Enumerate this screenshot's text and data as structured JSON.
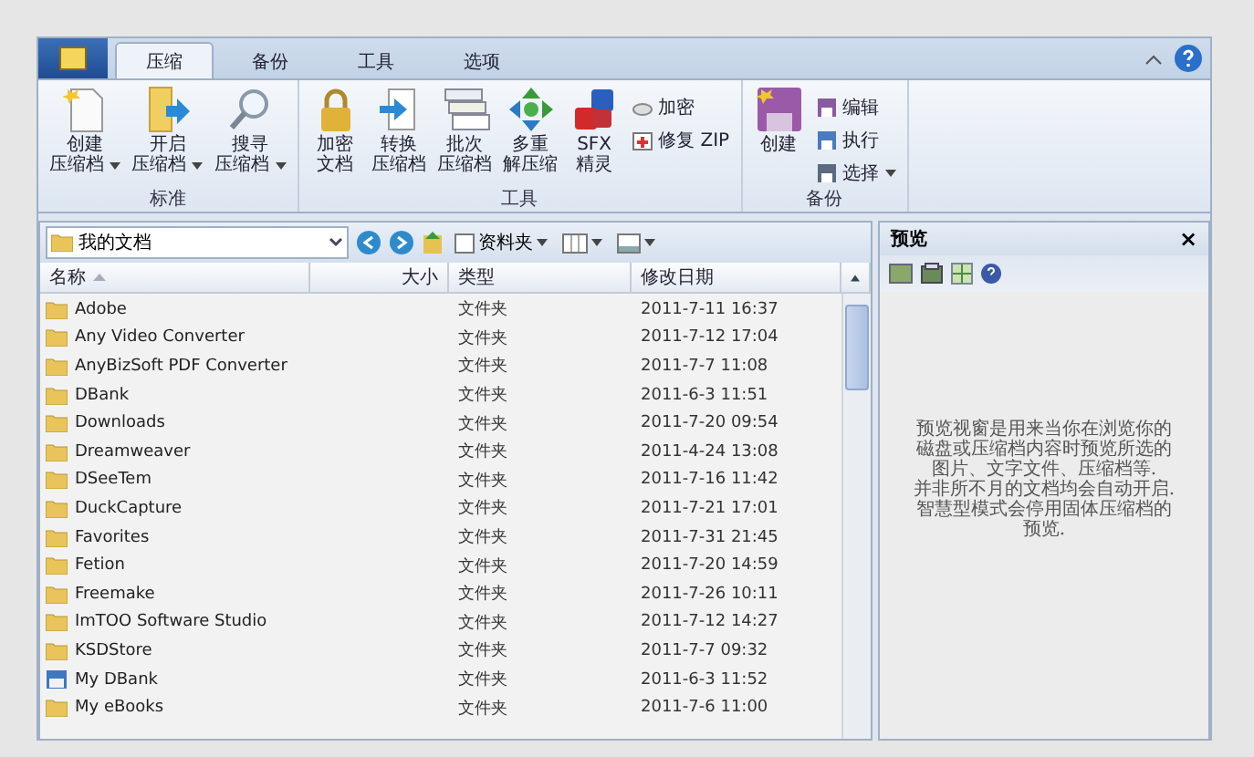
{
  "tabs": [
    {
      "label": "压缩",
      "selected": true
    },
    {
      "label": "备份",
      "selected": false
    },
    {
      "label": "工具",
      "selected": false
    },
    {
      "label": "选项",
      "selected": false
    }
  ],
  "ribbon_groups": [
    {
      "label": "标准",
      "items": [
        {
          "kind": "large",
          "lines": [
            "创建",
            "压缩档"
          ],
          "dropdown": true
        },
        {
          "kind": "large",
          "lines": [
            "开启",
            "压缩档"
          ],
          "dropdown": true
        },
        {
          "kind": "large",
          "lines": [
            "搜寻",
            "压缩档"
          ],
          "dropdown": true
        }
      ]
    },
    {
      "label": "工具",
      "items": [
        {
          "kind": "large",
          "lines": [
            "加密",
            "文档"
          ],
          "dropdown": false
        },
        {
          "kind": "large",
          "lines": [
            "转换",
            "压缩档"
          ],
          "dropdown": false
        },
        {
          "kind": "large",
          "lines": [
            "批次",
            "压缩档"
          ],
          "dropdown": false
        },
        {
          "kind": "large",
          "lines": [
            "多重",
            "解压缩"
          ],
          "dropdown": false
        },
        {
          "kind": "large",
          "lines": [
            "SFX",
            "精灵"
          ],
          "dropdown": false
        },
        {
          "kind": "small",
          "lines": [
            "加密"
          ],
          "dropdown": false
        },
        {
          "kind": "small",
          "lines": [
            "修复 ZIP"
          ],
          "dropdown": false
        }
      ]
    },
    {
      "label": "备份",
      "items": [
        {
          "kind": "large",
          "lines": [
            "创建"
          ],
          "dropdown": false
        },
        {
          "kind": "small",
          "lines": [
            "编辑"
          ],
          "dropdown": false
        },
        {
          "kind": "small",
          "lines": [
            "执行"
          ],
          "dropdown": false
        },
        {
          "kind": "small",
          "lines": [
            "选择"
          ],
          "dropdown": true
        }
      ]
    }
  ],
  "address": {
    "value": "我的文档"
  },
  "toolbar": {
    "folders_button": "资料夹"
  },
  "columns": [
    {
      "label": "名称",
      "sorted": true
    },
    {
      "label": "大小",
      "sorted": false
    },
    {
      "label": "类型",
      "sorted": false
    },
    {
      "label": "修改日期",
      "sorted": false
    }
  ],
  "rows": [
    {
      "kind": "folder",
      "name": "Adobe",
      "type": "文件夹",
      "date": "2011-7-11 16:37"
    },
    {
      "kind": "folder",
      "name": "Any Video Converter",
      "type": "文件夹",
      "date": "2011-7-12 17:04"
    },
    {
      "kind": "folder",
      "name": "AnyBizSoft PDF Converter",
      "type": "文件夹",
      "date": "2011-7-7 11:08"
    },
    {
      "kind": "folder",
      "name": "DBank",
      "type": "文件夹",
      "date": "2011-6-3 11:51"
    },
    {
      "kind": "folder",
      "name": "Downloads",
      "type": "文件夹",
      "date": "2011-7-20 09:54"
    },
    {
      "kind": "folder",
      "name": "Dreamweaver",
      "type": "文件夹",
      "date": "2011-4-24 13:08"
    },
    {
      "kind": "folder",
      "name": "DSeeTem",
      "type": "文件夹",
      "date": "2011-7-16 11:42"
    },
    {
      "kind": "folder",
      "name": "DuckCapture",
      "type": "文件夹",
      "date": "2011-7-21 17:01"
    },
    {
      "kind": "folder",
      "name": "Favorites",
      "type": "文件夹",
      "date": "2011-7-31 21:45"
    },
    {
      "kind": "folder",
      "name": "Fetion",
      "type": "文件夹",
      "date": "2011-7-20 14:59"
    },
    {
      "kind": "folder",
      "name": "Freemake",
      "type": "文件夹",
      "date": "2011-7-26 10:11"
    },
    {
      "kind": "folder",
      "name": "ImTOO Software Studio",
      "type": "文件夹",
      "date": "2011-7-12 14:27"
    },
    {
      "kind": "folder",
      "name": "KSDStore",
      "type": "文件夹",
      "date": "2011-7-7 09:32"
    },
    {
      "kind": "special",
      "name": "My DBank",
      "type": "文件夹",
      "date": "2011-6-3 11:52"
    },
    {
      "kind": "folder",
      "name": "My eBooks",
      "type": "文件夹",
      "date": "2011-7-6 11:00"
    }
  ],
  "preview": {
    "title": "预览",
    "close": "×",
    "lines": [
      "预览视窗是用来当你在浏览你的",
      "磁盘或压缩档内容时预览所选的",
      "图片、文字文件、压缩档等.",
      "并非所不月的文档均会自动开启.",
      "智慧型模式会停用固体压缩档的",
      "预览."
    ]
  }
}
